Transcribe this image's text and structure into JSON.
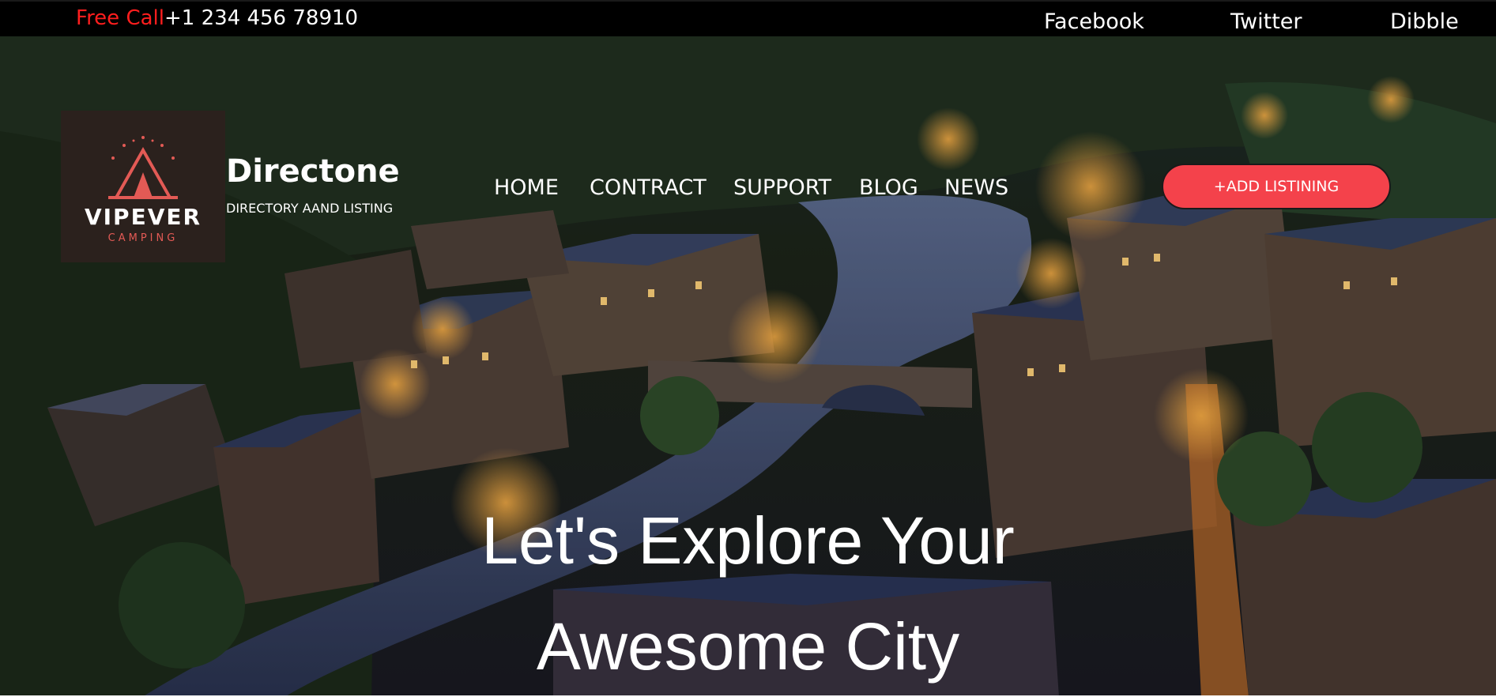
{
  "topbar": {
    "free_call_label": "Free Call",
    "phone": "+1 234 456 78910",
    "social": [
      "Facebook",
      "Twitter",
      "Dibble"
    ]
  },
  "brand": {
    "logo_text": "VIPEVER",
    "logo_subtext": "CAMPING",
    "title": "Directone",
    "tagline": "DIRECTORY AAND LISTING"
  },
  "nav": {
    "items": [
      "HOME",
      "CONTRACT",
      "SUPPORT",
      "BLOG",
      "NEWS"
    ],
    "cta_label": "+ADD LISTINING"
  },
  "hero": {
    "headline_line1": "Let's Explore Your",
    "headline_line2": "Awesome City"
  },
  "colors": {
    "accent": "#f4424b",
    "free_call": "#ff1e1e",
    "topbar_bg": "#000000",
    "logo_bg": "#2b211d"
  }
}
